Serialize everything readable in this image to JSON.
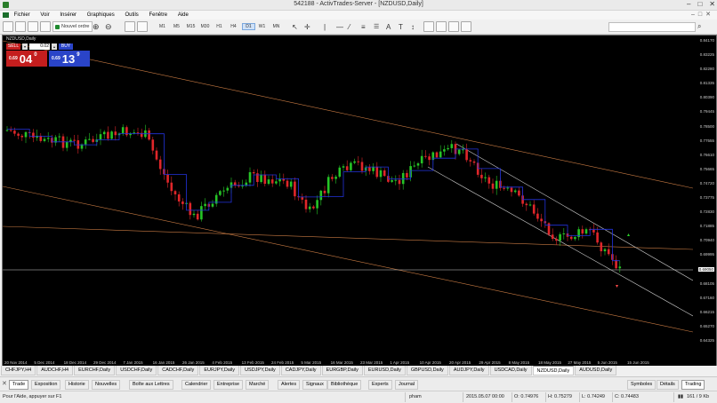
{
  "window": {
    "title": "542188 - ActivTrades-Server - [NZDUSD,Daily]"
  },
  "menu": [
    "Fichier",
    "Voir",
    "Insérer",
    "Graphiques",
    "Outils",
    "Fenêtre",
    "Aide"
  ],
  "toolbar": {
    "new_order_label": "Nouvel ordre",
    "timeframes": [
      "M1",
      "M5",
      "M15",
      "M30",
      "H1",
      "H4",
      "D1",
      "W1",
      "MN"
    ],
    "active_timeframe": "D1"
  },
  "chart": {
    "symbol_label": "NZDUSD,Daily",
    "trade_panel": {
      "sell_label": "SELL",
      "lot": "0.02",
      "buy_label": "BUY",
      "sell_price_small": "0.69",
      "sell_price_big": "04",
      "sell_price_sup": "0",
      "buy_price_small": "0.69",
      "buy_price_big": "13",
      "buy_price_sup": "9"
    },
    "colors": {
      "background": "#000000",
      "bull": "#26c426",
      "bear": "#e0262a",
      "ma_line": "#2233dd",
      "trend_line": "#c97b43",
      "channel_line": "#d8d8d8"
    },
    "y_axis": [
      "0.84170",
      "0.83225",
      "0.82280",
      "0.81335",
      "0.80390",
      "0.79445",
      "0.78500",
      "0.77555",
      "0.76610",
      "0.75665",
      "0.74720",
      "0.73775",
      "0.72830",
      "0.71885",
      "0.70940",
      "0.69995",
      "0.69050",
      "0.68105",
      "0.67160",
      "0.66215",
      "0.65270",
      "0.64325"
    ],
    "current_price": "0.69050",
    "x_axis": [
      "20 Nov 2014",
      "5 Dec 2014",
      "18 Dec 2014",
      "29 Dec 2014",
      "7 Jan 2015",
      "16 Jan 2015",
      "26 Jan 2015",
      "4 Feb 2015",
      "13 Feb 2015",
      "24 Feb 2015",
      "5 Mar 2015",
      "16 Mar 2015",
      "23 Mar 2015",
      "1 Apr 2015",
      "10 Apr 2015",
      "20 Apr 2015",
      "29 Apr 2015",
      "8 May 2015",
      "18 May 2015",
      "27 May 2015",
      "5 Jun 2015",
      "15 Jun 2015"
    ]
  },
  "chart_tabs": [
    "CHFJPY,H4",
    "AUDCHF,H4",
    "EURCHF,Daily",
    "USDCHF,Daily",
    "CADCHF,Daily",
    "EURJPY,Daily",
    "USDJPY,Daily",
    "CADJPY,Daily",
    "EURGBP,Daily",
    "EURUSD,Daily",
    "GBPUSD,Daily",
    "AUDJPY,Daily",
    "USDCAD,Daily",
    "NZDUSD,Daily",
    "AUDUSD,Daily"
  ],
  "active_chart_tab": "NZDUSD,Daily",
  "terminal_tabs": [
    "Trade",
    "Exposition",
    "Historie",
    "Nouvelles",
    "Boîte aux Lettres",
    "Calendrier",
    "Entreprise",
    "Marché",
    "Alertes",
    "Signaux",
    "Bibliothèque",
    "Experts",
    "Journal"
  ],
  "right_tabs": [
    "Symboles",
    "Détails",
    "Trading"
  ],
  "status": {
    "help": "Pour l'Aide, appuyer sur F1",
    "profile": "pham",
    "datetime": "2015.05.07 00:00",
    "open": "O: 0.74976",
    "high": "H: 0.75279",
    "low": "L: 0.74249",
    "close": "C: 0.74483",
    "traffic": "161 / 9 Kb"
  }
}
